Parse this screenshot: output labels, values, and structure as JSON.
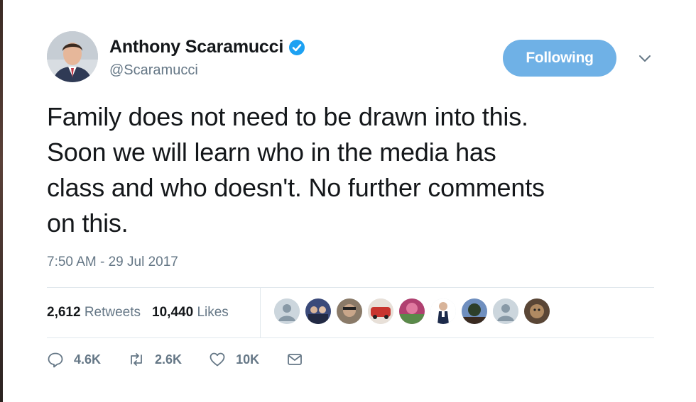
{
  "author": {
    "name": "Anthony Scaramucci",
    "handle": "@Scaramucci",
    "verified": true
  },
  "follow_button": {
    "label": "Following",
    "color": "#6fb1e6"
  },
  "tweet": {
    "lines": [
      "Family does not need to be drawn into this.",
      "Soon we will learn who in the media has",
      "class and who doesn't. No further comments",
      "on this."
    ],
    "timestamp": "7:50 AM - 29 Jul 2017"
  },
  "stats": {
    "retweets_count": "2,612",
    "retweets_label": "Retweets",
    "likes_count": "10,440",
    "likes_label": "Likes"
  },
  "liker_avatars": [
    {
      "kind": "default-avatar",
      "color": "#ccd6dd"
    },
    {
      "kind": "photo",
      "color": "#3b4a7a"
    },
    {
      "kind": "photo",
      "color": "#6b5a48"
    },
    {
      "kind": "photo",
      "color": "#c8352e"
    },
    {
      "kind": "photo",
      "color": "#b04070"
    },
    {
      "kind": "photo",
      "color": "#ffffff"
    },
    {
      "kind": "photo",
      "color": "#2d3f5c"
    },
    {
      "kind": "default-avatar",
      "color": "#ccd6dd"
    },
    {
      "kind": "photo",
      "color": "#7a5a3a"
    }
  ],
  "actions": {
    "reply_count": "4.6K",
    "retweet_count": "2.6K",
    "like_count": "10K"
  },
  "colors": {
    "text": "#14171a",
    "secondary": "#657786",
    "verified": "#1da1f2",
    "divider": "#e1e8ed"
  }
}
